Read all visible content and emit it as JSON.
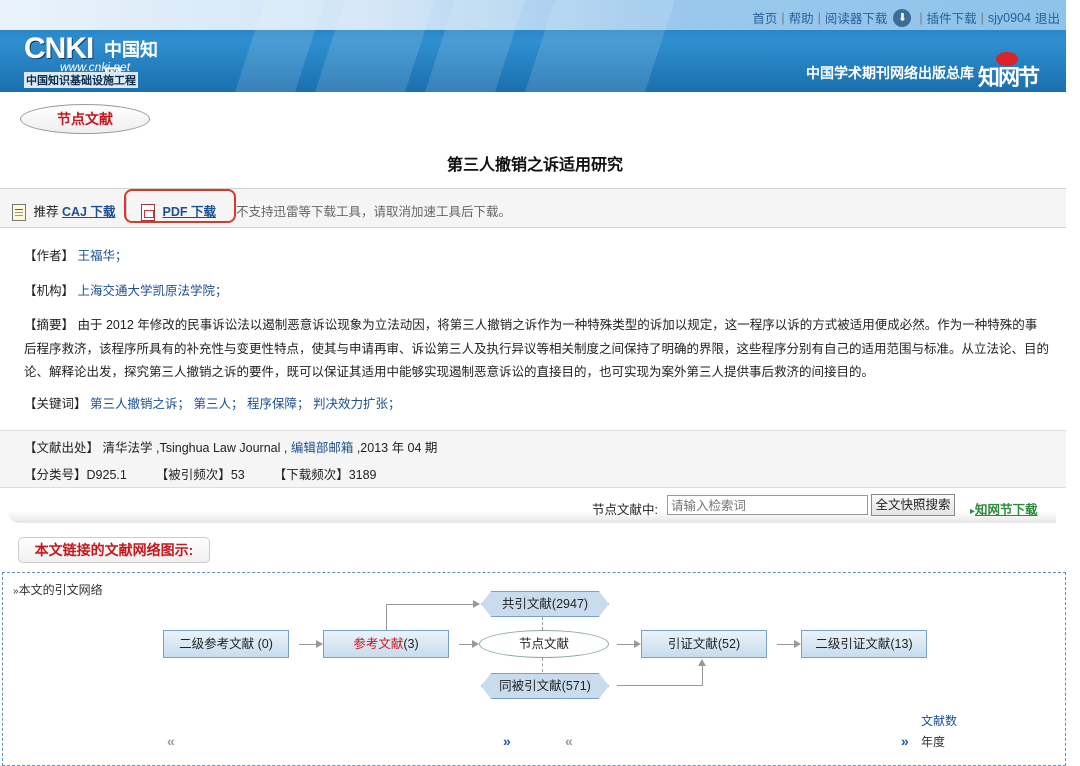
{
  "header": {
    "logo_main": "CNKI",
    "logo_cn": "中国知网",
    "logo_url": "www.cnki.net",
    "logo_sub": "中国知识基础设施工程",
    "links": [
      "首页",
      "帮助",
      "阅读器下载",
      "插件下载",
      "sjy0904",
      "退出"
    ],
    "publisher": "中国学术期刊网络出版总库",
    "zhiwang_logo": "知网节"
  },
  "node_badge": "节点文献",
  "article_title": "第三人撤销之诉适用研究",
  "download_bar": {
    "recommend": "推荐",
    "caj_label": "CAJ 下载",
    "pdf_label": "PDF 下载",
    "notice": "不支持迅雷等下载工具，请取消加速工具后下载。"
  },
  "info": {
    "author_label": "【作者】",
    "author": "王福华；",
    "org_label": "【机构】",
    "org": "上海交通大学凯原法学院；",
    "abstract_label": "【摘要】",
    "abstract": "由于 2012 年修改的民事诉讼法以遏制恶意诉讼现象为立法动因，将第三人撤销之诉作为一种特殊类型的诉加以规定，这一程序以诉的方式被适用便成必然。作为一种特殊的事后程序救济，该程序所具有的补充性与变更性特点，使其与申请再审、诉讼第三人及执行异议等相关制度之间保持了明确的界限，这些程序分别有自己的适用范围与标准。从立法论、目的论、解释论出发，探究第三人撤销之诉的要件，既可以保证其适用中能够实现遏制恶意诉讼的直接目的，也可实现为案外第三人提供事后救济的间接目的。",
    "keywords_label": "【关键词】",
    "keywords": [
      "第三人撤销之诉；",
      "第三人；",
      "程序保障；",
      "判决效力扩张；"
    ]
  },
  "source": {
    "source_label": "【文献出处】",
    "journal_cn": "清华法学",
    "journal_en": ",Tsinghua Law Journal ,",
    "editor_link": "编辑部邮箱",
    "issue": ",2013 年 04 期",
    "class_label": "【分类号】",
    "class_no": "D925.1",
    "cited_label": "【被引频次】",
    "cited": "53",
    "download_label": "【下载频次】",
    "downloads": "3189"
  },
  "search": {
    "label": "节点文献中:",
    "placeholder": "请输入检索词",
    "button": "全文快照搜索",
    "link": "知网节下载"
  },
  "network": {
    "title": "本文链接的文献网络图示:",
    "caption": "本文的引文网络",
    "level2_refs": "二级参考文献 (0)",
    "refs_prefix": "参考文献",
    "refs_count": "(3)",
    "node": "节点文献",
    "cocited": "共引文献(2947)",
    "cocitedby": "同被引文献(571)",
    "citing": "引证文献(52)",
    "level2_citing": "二级引证文献(13)",
    "legend_count": "文献数",
    "legend_year": "年度"
  }
}
